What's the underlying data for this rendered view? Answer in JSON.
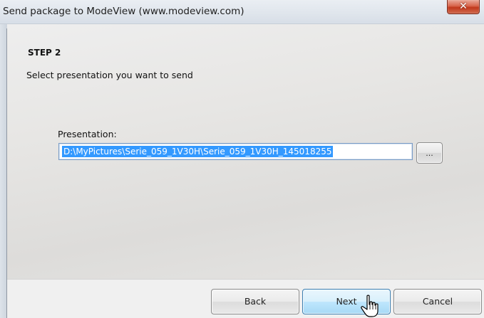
{
  "window": {
    "title": "Send package to ModeView (www.modeview.com)",
    "close_glyph": "✕"
  },
  "step": {
    "title": "STEP 2",
    "description": "Select presentation you want to send"
  },
  "presentation": {
    "label": "Presentation:",
    "value": "D:\\MyPictures\\Serie_059_1V30H\\Serie_059_1V30H_145018255",
    "browse_label": "..."
  },
  "buttons": {
    "back": "Back",
    "next": "Next",
    "cancel": "Cancel"
  },
  "colors": {
    "selection": "#3399ff",
    "close_button": "#c1381c",
    "next_button_highlight": "#bee6fd"
  },
  "icons": {
    "cursor": "hand-pointer-icon"
  }
}
